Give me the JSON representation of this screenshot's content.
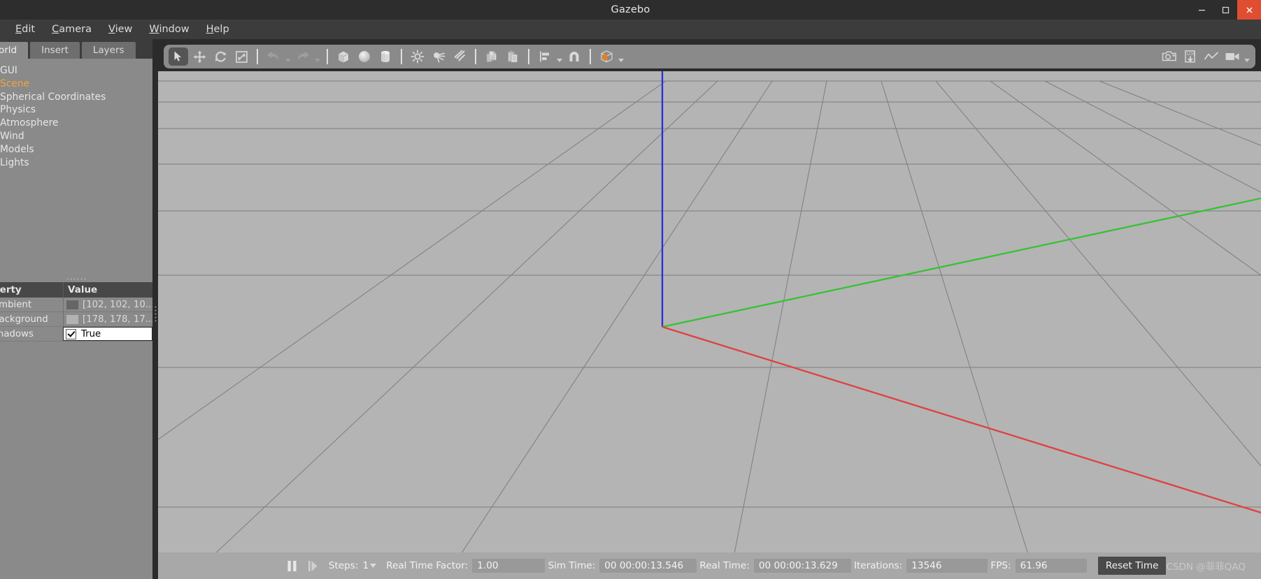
{
  "window": {
    "title": "Gazebo",
    "controls": [
      {
        "name": "minimize",
        "glyph": "minimize"
      },
      {
        "name": "maximize",
        "glyph": "maximize"
      },
      {
        "name": "close",
        "glyph": "close"
      }
    ]
  },
  "menubar": {
    "items": [
      {
        "label": "Edit",
        "mnemonic": "E"
      },
      {
        "label": "Camera",
        "mnemonic": "C"
      },
      {
        "label": "View",
        "mnemonic": "V"
      },
      {
        "label": "Window",
        "mnemonic": "W"
      },
      {
        "label": "Help",
        "mnemonic": "H"
      }
    ]
  },
  "left_panel": {
    "tabs": [
      {
        "label": "orld",
        "full_label": "World",
        "active": true
      },
      {
        "label": "Insert",
        "active": false
      },
      {
        "label": "Layers",
        "active": false
      }
    ],
    "tree_items": [
      {
        "label": "GUI",
        "selected": false
      },
      {
        "label": "Scene",
        "selected": true
      },
      {
        "label": "Spherical Coordinates",
        "selected": false
      },
      {
        "label": "Physics",
        "selected": false
      },
      {
        "label": "Atmosphere",
        "selected": false
      },
      {
        "label": "Wind",
        "selected": false
      },
      {
        "label": "Models",
        "selected": false
      },
      {
        "label": "Lights",
        "selected": false
      }
    ],
    "property_table": {
      "headers": {
        "property": "perty",
        "property_full": "Property",
        "value": "Value"
      },
      "rows": [
        {
          "name": "ambient",
          "value": "[102, 102, 10...",
          "swatch": "#666666",
          "kind": "color"
        },
        {
          "name": "background",
          "value": "[178, 178, 17...",
          "swatch": "#b2b2b2",
          "kind": "color"
        },
        {
          "name": "shadows",
          "value": "True",
          "kind": "bool",
          "checked": true,
          "editing": true
        }
      ]
    }
  },
  "toolbar": {
    "left_items": [
      {
        "name": "select-mode",
        "icon": "cursor-arrow-icon",
        "active": true
      },
      {
        "name": "translate-mode",
        "icon": "move-arrows-icon",
        "active": false
      },
      {
        "name": "rotate-mode",
        "icon": "rotate-icon",
        "active": false
      },
      {
        "name": "scale-mode",
        "icon": "scale-icon",
        "active": false
      },
      {
        "name": "separator-1",
        "icon": "separator"
      },
      {
        "name": "undo",
        "icon": "undo-arrow-icon",
        "active": false
      },
      {
        "name": "undo-menu",
        "icon": "caret-down-icon"
      },
      {
        "name": "redo",
        "icon": "redo-arrow-icon",
        "active": false
      },
      {
        "name": "redo-menu",
        "icon": "caret-down-icon"
      },
      {
        "name": "separator-2",
        "icon": "separator"
      },
      {
        "name": "insert-box",
        "icon": "box-icon",
        "active": false
      },
      {
        "name": "insert-sphere",
        "icon": "sphere-icon",
        "active": false
      },
      {
        "name": "insert-cylinder",
        "icon": "cylinder-icon",
        "active": false
      },
      {
        "name": "separator-3",
        "icon": "separator"
      },
      {
        "name": "point-light",
        "icon": "point-light-icon",
        "active": false
      },
      {
        "name": "spot-light",
        "icon": "spot-light-icon",
        "active": false
      },
      {
        "name": "directional-light",
        "icon": "directional-light-icon",
        "active": false
      },
      {
        "name": "separator-4",
        "icon": "separator"
      },
      {
        "name": "copy",
        "icon": "copy-icon",
        "active": false
      },
      {
        "name": "paste",
        "icon": "paste-icon",
        "active": false
      },
      {
        "name": "separator-5",
        "icon": "separator"
      },
      {
        "name": "align",
        "icon": "align-icon",
        "active": false
      },
      {
        "name": "align-menu",
        "icon": "caret-down-icon"
      },
      {
        "name": "snap",
        "icon": "magnet-icon",
        "active": false
      },
      {
        "name": "separator-6",
        "icon": "separator"
      },
      {
        "name": "view-angle",
        "icon": "view-cube-icon",
        "active": false
      },
      {
        "name": "view-angle-menu",
        "icon": "caret-down-icon"
      }
    ],
    "right_items": [
      {
        "name": "screenshot",
        "icon": "camera-icon"
      },
      {
        "name": "log-record",
        "icon": "log-download-icon"
      },
      {
        "name": "plot",
        "icon": "plot-line-icon"
      },
      {
        "name": "video-record",
        "icon": "video-camera-icon"
      },
      {
        "name": "video-record-menu",
        "icon": "caret-down-icon"
      }
    ],
    "accent_color": "#ef7d14"
  },
  "viewport": {
    "background_color": "#b4b4b4",
    "grid_color": "#7d7d7d",
    "axes": {
      "x_color": "#e04040",
      "y_color": "#35c235",
      "z_color": "#2b2bdd"
    }
  },
  "statusbar": {
    "pause_icon": "pause-icon",
    "step_icon": "step-forward-icon",
    "steps_label": "Steps:",
    "steps_value": "1",
    "real_time_factor_label": "Real Time Factor:",
    "real_time_factor_value": "1.00",
    "sim_time_label": "Sim Time:",
    "sim_time_value": "00 00:00:13.546",
    "real_time_label": "Real Time:",
    "real_time_value": "00 00:00:13.629",
    "iterations_label": "Iterations:",
    "iterations_value": "13546",
    "fps_label": "FPS:",
    "fps_value": "61.96",
    "reset_button": "Reset Time",
    "watermark": "CSDN @菲菲QAQ"
  }
}
